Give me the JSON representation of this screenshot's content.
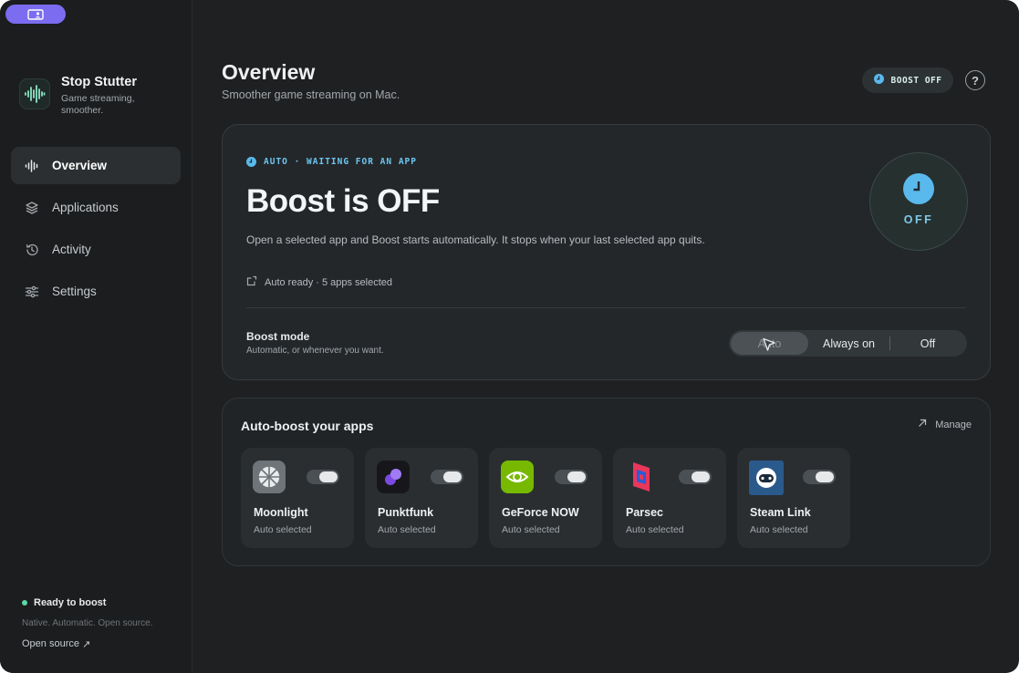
{
  "brand": {
    "name": "Stop Stutter",
    "tagline": "Game streaming, smoother."
  },
  "sidebar": {
    "items": [
      {
        "label": "Overview",
        "icon": "waveform-icon",
        "active": true
      },
      {
        "label": "Applications",
        "icon": "layers-icon",
        "active": false
      },
      {
        "label": "Activity",
        "icon": "history-icon",
        "active": false
      },
      {
        "label": "Settings",
        "icon": "sliders-icon",
        "active": false
      }
    ],
    "footer": {
      "status": "Ready to boost",
      "tagline": "Native. Automatic. Open source.",
      "link": "Open source",
      "link_arrow": "↗"
    }
  },
  "header": {
    "title": "Overview",
    "subtitle": "Smoother game streaming on Mac.",
    "boost_badge": "BOOST OFF",
    "help": "?"
  },
  "hero": {
    "status": "AUTO · WAITING FOR AN APP",
    "title": "Boost is OFF",
    "description": "Open a selected app and Boost starts automatically. It stops when your last selected app quits.",
    "meta": "Auto ready · 5 apps selected",
    "mode_label": "Boost mode",
    "mode_sub": "Automatic, or whenever you want.",
    "modes": [
      "Auto",
      "Always on",
      "Off"
    ],
    "selected_mode": "Auto",
    "dial_label": "OFF"
  },
  "apps": {
    "title": "Auto-boost your apps",
    "manage": "Manage",
    "items": [
      {
        "name": "Moonlight",
        "status": "Auto selected",
        "enabled": true
      },
      {
        "name": "Punktfunk",
        "status": "Auto selected",
        "enabled": true
      },
      {
        "name": "GeForce NOW",
        "status": "Auto selected",
        "enabled": true
      },
      {
        "name": "Parsec",
        "status": "Auto selected",
        "enabled": true
      },
      {
        "name": "Steam Link",
        "status": "Auto selected",
        "enabled": true
      }
    ]
  },
  "colors": {
    "accent": "#5ab9ec",
    "ready": "#5ed6a8",
    "window_button": "#7b6cf0"
  }
}
